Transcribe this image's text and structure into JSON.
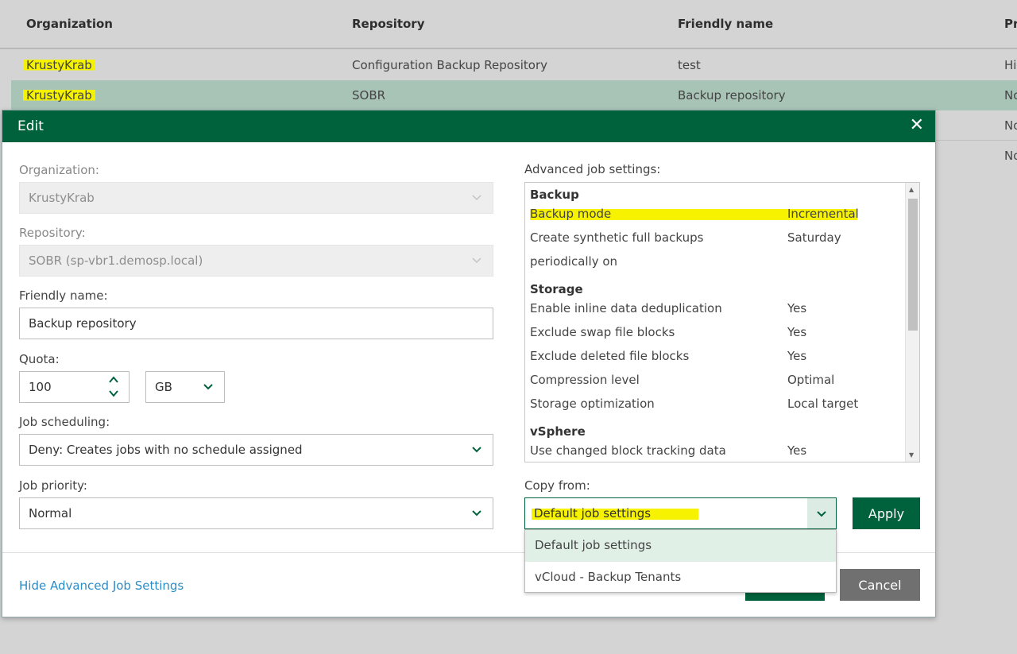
{
  "table": {
    "columns": [
      "Organization",
      "Repository",
      "Friendly name",
      "Pr"
    ],
    "rows": [
      {
        "organization": "KrustyKrab",
        "repository": "Configuration Backup Repository",
        "friendly_name": "test",
        "extra": "Hi"
      },
      {
        "organization": "KrustyKrab",
        "repository": "SOBR",
        "friendly_name": "Backup repository",
        "extra": "No"
      }
    ],
    "extra_cells": [
      "No",
      "No"
    ]
  },
  "dialog": {
    "title": "Edit",
    "organization": {
      "label": "Organization:",
      "value": "KrustyKrab"
    },
    "repository": {
      "label": "Repository:",
      "value": "SOBR (sp-vbr1.demosp.local)"
    },
    "friendly_name": {
      "label": "Friendly name:",
      "value": "Backup repository"
    },
    "quota": {
      "label": "Quota:",
      "value": "100",
      "unit": "GB"
    },
    "job_scheduling": {
      "label": "Job scheduling:",
      "value": "Deny: Creates jobs with no schedule assigned"
    },
    "job_priority": {
      "label": "Job priority:",
      "value": "Normal"
    },
    "advanced": {
      "label": "Advanced job settings:",
      "sections": [
        {
          "title": "Backup",
          "items": [
            {
              "name": "Backup mode",
              "value": "Incremental"
            },
            {
              "name": "Create synthetic full backups",
              "value": "Saturday"
            },
            {
              "name": "periodically on",
              "value": ""
            }
          ]
        },
        {
          "title": "Storage",
          "items": [
            {
              "name": "Enable inline data deduplication",
              "value": "Yes"
            },
            {
              "name": "Exclude swap file blocks",
              "value": "Yes"
            },
            {
              "name": "Exclude deleted file blocks",
              "value": "Yes"
            },
            {
              "name": "Compression level",
              "value": "Optimal"
            },
            {
              "name": "Storage optimization",
              "value": "Local target"
            }
          ]
        },
        {
          "title": "vSphere",
          "items": [
            {
              "name": "Use changed block tracking data",
              "value": "Yes"
            }
          ]
        }
      ]
    },
    "copy_from": {
      "label": "Copy from:",
      "value": "Default job settings",
      "options": [
        "Default job settings",
        "vCloud - Backup Tenants"
      ]
    },
    "apply_label": "Apply",
    "cancel_label": "Cancel",
    "hide_link": "Hide Advanced Job Settings"
  },
  "colors": {
    "accent": "#00623c",
    "highlight": "#f5f200",
    "link": "#2a8cc9"
  }
}
